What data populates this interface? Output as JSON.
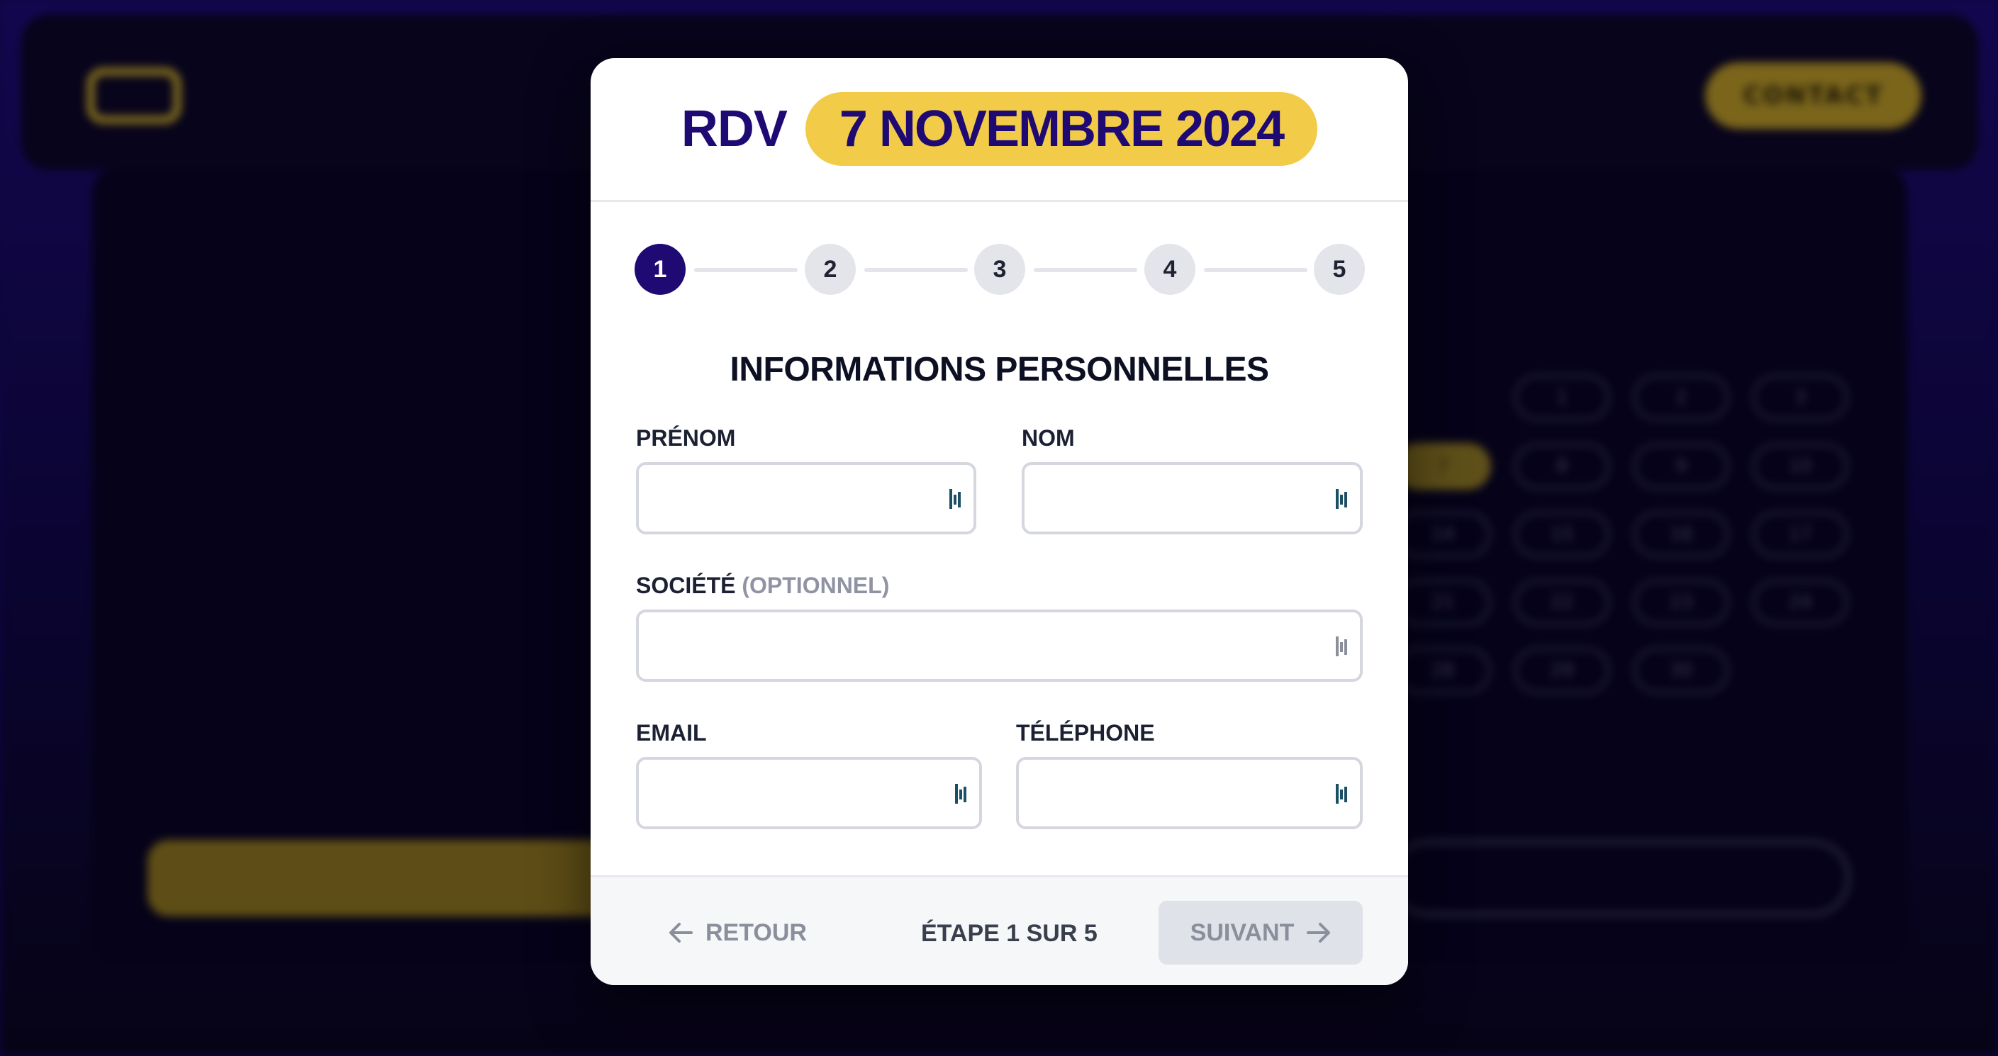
{
  "background": {
    "contact_label": "CONTACT",
    "calendar_days": [
      "1",
      "2",
      "3",
      "7",
      "8",
      "9",
      "10",
      "14",
      "15",
      "16",
      "17",
      "21",
      "22",
      "23",
      "24",
      "28",
      "29",
      "30"
    ],
    "selected_day": "7"
  },
  "modal": {
    "header": {
      "prefix": "RDV",
      "date": "7 NOVEMBRE 2024"
    },
    "steps": [
      "1",
      "2",
      "3",
      "4",
      "5"
    ],
    "active_step": 1,
    "section_title": "INFORMATIONS PERSONNELLES",
    "fields": {
      "first_name": {
        "label": "PRÉNOM",
        "value": ""
      },
      "last_name": {
        "label": "NOM",
        "value": ""
      },
      "company": {
        "label": "SOCIÉTÉ",
        "optional": "(OPTIONNEL)",
        "value": ""
      },
      "email": {
        "label": "EMAIL",
        "value": ""
      },
      "phone": {
        "label": "TÉLÉPHONE",
        "value": ""
      }
    },
    "footer": {
      "back_label": "RETOUR",
      "step_counter": "ÉTAPE 1 SUR 5",
      "next_label": "SUIVANT"
    }
  },
  "colors": {
    "brand_navy": "#1f0a73",
    "brand_yellow": "#f2cc48",
    "disabled_gray": "#8b8f9c"
  }
}
